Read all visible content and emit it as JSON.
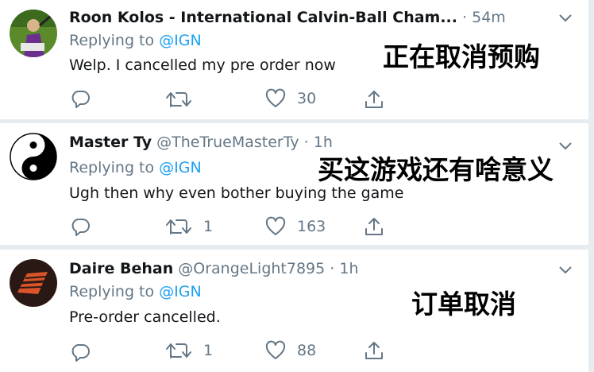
{
  "tweets": [
    {
      "name": "Roon Kolos - International Calvin-Ball Cham...",
      "handle": "",
      "time": "· 54m",
      "replying_prefix": "Replying to",
      "replying_to": "@IGN",
      "text": "Welp. I cancelled my pre order now",
      "caption": "正在取消预购",
      "replies": "",
      "retweets": "",
      "likes": "30"
    },
    {
      "name": "Master Ty",
      "handle": "@TheTrueMasterTy",
      "time": "· 1h",
      "replying_prefix": "Replying to",
      "replying_to": "@IGN",
      "text": "Ugh then why even bother buying the game",
      "caption": "买这游戏还有啥意义",
      "replies": "",
      "retweets": "1",
      "likes": "163"
    },
    {
      "name": "Daire Behan",
      "handle": "@OrangeLight7895",
      "time": "· 1h",
      "replying_prefix": "Replying to",
      "replying_to": "@IGN",
      "text": "Pre-order cancelled.",
      "caption": "订单取消",
      "replies": "",
      "retweets": "1",
      "likes": "88"
    }
  ],
  "icons": [
    "avatar",
    "chevron-down-icon",
    "reply-icon",
    "retweet-icon",
    "like-icon",
    "share-icon"
  ],
  "colors": {
    "link": "#1da1f2",
    "muted": "#657786",
    "text": "#14171a",
    "separator": "#e6ecf0"
  }
}
